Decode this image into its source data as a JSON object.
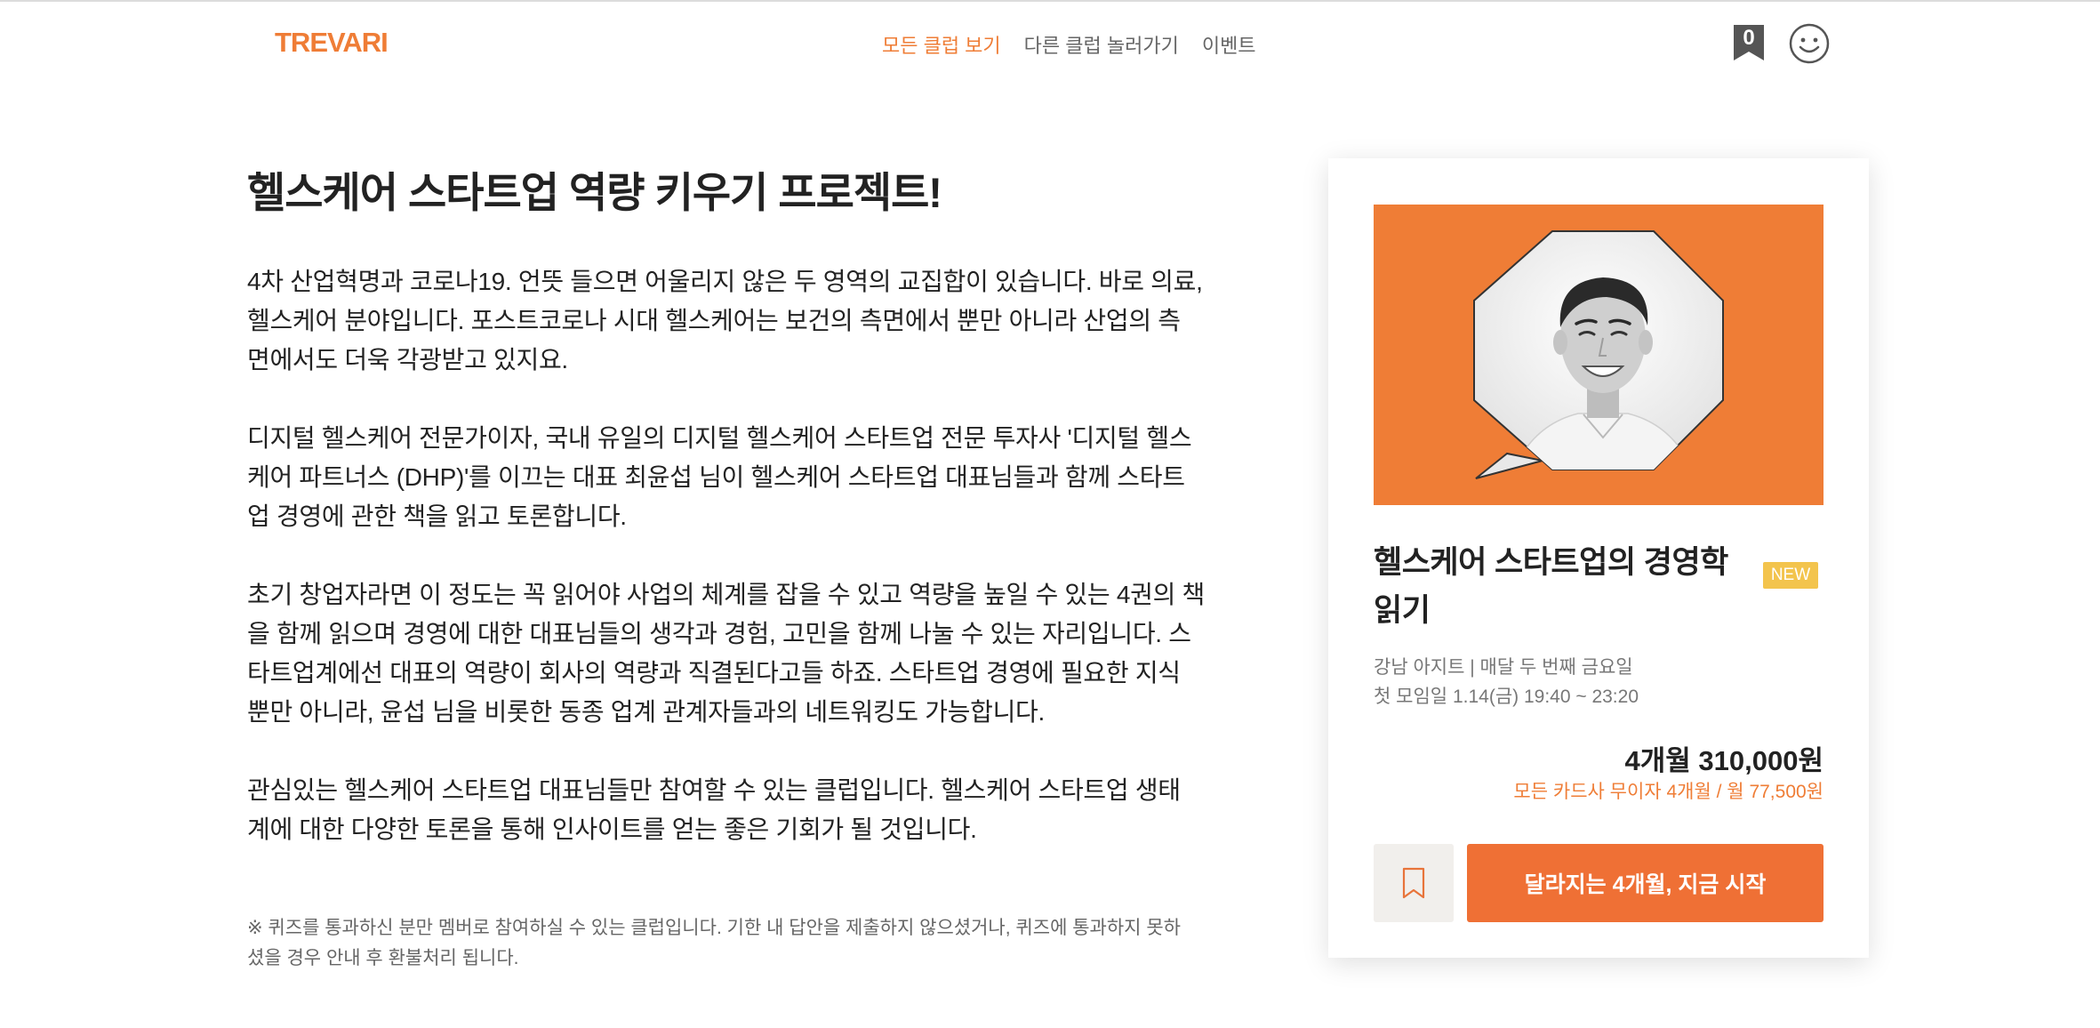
{
  "header": {
    "logo": "TREVARI",
    "nav": [
      {
        "label": "모든 클럽 보기",
        "active": true
      },
      {
        "label": "다른 클럽 놀러가기",
        "active": false
      },
      {
        "label": "이벤트",
        "active": false
      }
    ],
    "cart_count": "0",
    "icons": {
      "cart": "bookmark-cart-icon",
      "profile": "smiley-profile-icon"
    }
  },
  "main": {
    "title": "헬스케어 스타트업 역량 키우기 프로젝트!",
    "paragraphs": [
      [
        "4차 산업혁명과 코로나19. 언뜻 들으면 어울리지 않은 두 영역의 교집합이 있습니다. 바로 의료,",
        "헬스케어 분야입니다. 포스트코로나 시대 헬스케어는 보건의 측면에서 뿐만 아니라 산업의 측",
        "면에서도 더욱 각광받고 있지요."
      ],
      [
        "디지털 헬스케어 전문가이자, 국내 유일의 디지털 헬스케어 스타트업 전문 투자사 '디지털 헬스",
        "케어 파트너스 (DHP)'를 이끄는 대표 최윤섭 님이 헬스케어 스타트업 대표님들과 함께 스타트",
        "업 경영에 관한 책을 읽고 토론합니다."
      ],
      [
        "초기 창업자라면 이 정도는 꼭 읽어야 사업의 체계를 잡을 수 있고 역량을 높일 수 있는 4권의 책",
        "을 함께 읽으며 경영에 대한 대표님들의 생각과 경험, 고민을 함께 나눌 수 있는 자리입니다. 스",
        "타트업계에선 대표의 역량이 회사의 역량과 직결된다고들 하죠. 스타트업 경영에 필요한 지식",
        "뿐만 아니라, 윤섭 님을 비롯한 동종 업계 관계자들과의 네트워킹도 가능합니다."
      ],
      [
        "관심있는 헬스케어 스타트업 대표님들만 참여할 수 있는 클럽입니다. 헬스케어 스타트업 생태",
        "계에 대한 다양한 토론을 통해 인사이트를 얻는 좋은 기회가 될 것입니다."
      ]
    ],
    "note": [
      "※ 퀴즈를 통과하신 분만 멤버로 참여하실 수 있는 클럽입니다. 기한 내 답안을 제출하지 않으셨거나, 퀴즈에 통과하지 못하",
      "셨을 경우 안내 후 환불처리 됩니다."
    ]
  },
  "card": {
    "title_lines": [
      "헬스케어 스타트업의 경영학",
      "읽기"
    ],
    "badge": "NEW",
    "location": "강남 아지트 | 매달 두 번째 금요일",
    "first_meeting": "첫 모임일 1.14(금) 19:40 ~ 23:20",
    "price": "4개월 310,000원",
    "installment": "모든 카드사 무이자 4개월 / 월 77,500원",
    "cta": "달라지는 4개월, 지금 시작",
    "bookmark_icon": "bookmark-icon"
  },
  "colors": {
    "accent": "#ef7d36",
    "cta": "#ef7035",
    "badge": "#f3c44d",
    "text": "#222222",
    "muted": "#777777"
  }
}
